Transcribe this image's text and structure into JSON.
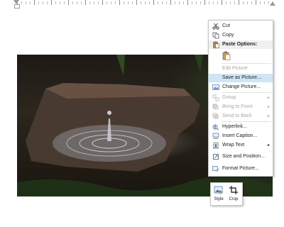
{
  "context_menu": {
    "items": [
      {
        "id": "cut",
        "label": "Cut",
        "icon": "scissors-icon",
        "disabled": false
      },
      {
        "id": "copy",
        "label": "Copy",
        "icon": "copy-icon",
        "disabled": false
      },
      {
        "id": "paste_options",
        "label": "Paste Options:",
        "icon": "paste-icon",
        "disabled": false
      },
      {
        "id": "edit_picture",
        "label": "Edit Picture",
        "icon": "",
        "disabled": true
      },
      {
        "id": "save_as_picture",
        "label": "Save as Picture...",
        "icon": "",
        "disabled": false,
        "highlighted": true
      },
      {
        "id": "change_picture",
        "label": "Change Picture...",
        "icon": "change-picture-icon",
        "disabled": false
      },
      {
        "id": "group",
        "label": "Group",
        "icon": "group-icon",
        "disabled": true,
        "submenu": true
      },
      {
        "id": "bring_to_front",
        "label": "Bring to Front",
        "icon": "bring-to-front-icon",
        "disabled": true,
        "submenu": true
      },
      {
        "id": "send_to_back",
        "label": "Send to Back",
        "icon": "send-to-back-icon",
        "disabled": true,
        "submenu": true
      },
      {
        "id": "hyperlink",
        "label": "Hyperlink...",
        "icon": "hyperlink-icon",
        "disabled": false
      },
      {
        "id": "insert_caption",
        "label": "Insert Caption...",
        "icon": "insert-caption-icon",
        "disabled": false
      },
      {
        "id": "wrap_text",
        "label": "Wrap Text",
        "icon": "wrap-text-icon",
        "disabled": false,
        "submenu": true
      },
      {
        "id": "size_and_position",
        "label": "Size and Position...",
        "icon": "size-position-icon",
        "disabled": false
      },
      {
        "id": "format_picture",
        "label": "Format Picture...",
        "icon": "format-picture-icon",
        "disabled": false
      }
    ],
    "submenu_arrow": "▸"
  },
  "mini_toolbar": {
    "style_label": "Style",
    "crop_label": "Crop"
  },
  "colors": {
    "menu_highlight": "#cde6f7",
    "disabled_text": "#a6a6a6"
  }
}
